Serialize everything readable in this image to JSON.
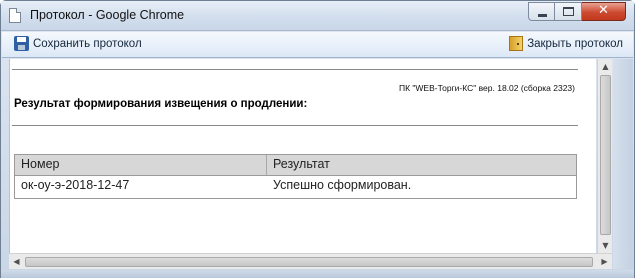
{
  "window": {
    "title": "Протокол - Google Chrome"
  },
  "toolbar": {
    "save_label": "Сохранить протокол",
    "close_label": "Закрыть протокол"
  },
  "report": {
    "version_text": "ПК \"WEB-Торги-КС\" вер. 18.02 (сборка 2323)",
    "heading": "Результат формирования извещения о продлении:",
    "columns": [
      "Номер",
      "Результат"
    ],
    "rows": [
      [
        "ок-оу-э-2018-12-47",
        "Успешно сформирован."
      ]
    ]
  },
  "icons": {
    "page": "page-icon",
    "save": "floppy-disk-icon",
    "close_protocol": "door-exit-icon"
  },
  "colors": {
    "titlebar": "#d3dfee",
    "close_button": "#cc4a31",
    "table_header": "#d7d7d7"
  }
}
